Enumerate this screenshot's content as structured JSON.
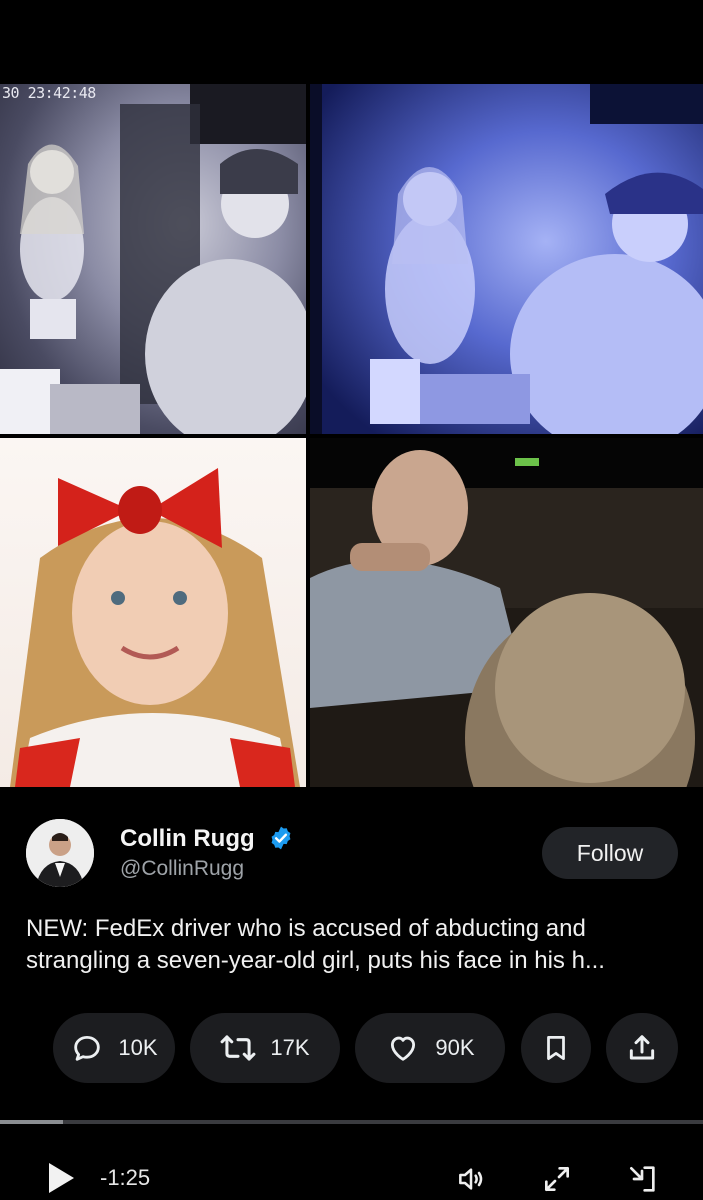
{
  "media": {
    "timestamp": "30 23:42:48"
  },
  "post": {
    "display_name": "Collin Rugg",
    "handle": "@CollinRugg",
    "follow_label": "Follow",
    "text": "NEW: FedEx driver who is accused of abducting and strangling a seven-year-old girl, puts his face in his h...",
    "actions": {
      "replies": "10K",
      "reposts": "17K",
      "likes": "90K"
    }
  },
  "player": {
    "time_remaining": "-1:25",
    "progress_fraction": 0.09
  },
  "colors": {
    "background": "#000000",
    "verified_badge": "#1d9bf0",
    "button_bg": "#1c1d20"
  },
  "icons": {
    "verified": "verified-badge-icon",
    "reply": "speech-bubble-icon",
    "repost": "repost-arrows-icon",
    "like": "heart-icon",
    "bookmark": "bookmark-icon",
    "share": "share-upload-icon",
    "play": "play-icon",
    "volume": "volume-icon",
    "fullscreen": "expand-arrows-icon",
    "exit": "exit-player-icon"
  }
}
